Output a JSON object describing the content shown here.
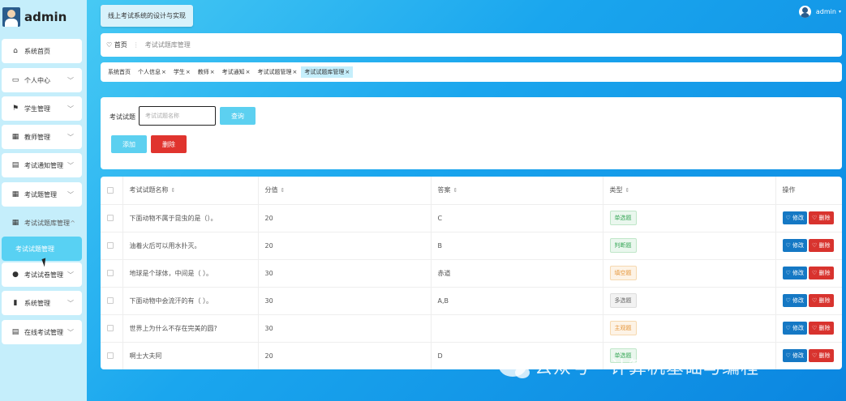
{
  "app": {
    "title": "admin",
    "system_title": "线上考试系统的设计与实现",
    "user": "admin"
  },
  "sidebar": {
    "items": [
      {
        "label": "系统首页",
        "icon": "home-icon",
        "glyph": "⌂"
      },
      {
        "label": "个人中心",
        "icon": "person-icon",
        "glyph": "▭",
        "chevron": "﹀"
      },
      {
        "label": "学生管理",
        "icon": "flag-icon",
        "glyph": "⚑",
        "chevron": "﹀"
      },
      {
        "label": "教师管理",
        "icon": "grid-icon",
        "glyph": "▦",
        "chevron": "﹀"
      },
      {
        "label": "考试通知管理",
        "icon": "clipboard-icon",
        "glyph": "▤",
        "chevron": "﹀"
      },
      {
        "label": "考试题管理",
        "icon": "grid-icon",
        "glyph": "▦",
        "chevron": "﹀"
      },
      {
        "label": "考试试题库管理",
        "icon": "grid-icon",
        "glyph": "▦",
        "chevron": "^"
      },
      {
        "label": "考试试题管理",
        "icon": "sub-item",
        "glyph": ""
      },
      {
        "label": "考试试卷管理",
        "icon": "pin-icon",
        "glyph": "●",
        "chevron": "﹀"
      },
      {
        "label": "系统管理",
        "icon": "chart-icon",
        "glyph": "▮",
        "chevron": "﹀"
      },
      {
        "label": "在线考试管理",
        "icon": "doc-icon",
        "glyph": "▤",
        "chevron": "﹀"
      }
    ]
  },
  "breadcrumb": {
    "home": "♡ 首页",
    "sep": "⋮",
    "current": "考试试题库管理"
  },
  "tabs": [
    {
      "label": "系统首页",
      "close": ""
    },
    {
      "label": "个人信息",
      "close": "×"
    },
    {
      "label": "学生",
      "close": "×"
    },
    {
      "label": "教师",
      "close": "×"
    },
    {
      "label": "考试通知",
      "close": "×"
    },
    {
      "label": "考试试题管理",
      "close": "×"
    },
    {
      "label": "考试试题库管理",
      "close": "×"
    }
  ],
  "search": {
    "label": "考试试题",
    "placeholder": "考试试题名称",
    "query_button": "查询",
    "add_button": "添加",
    "delete_button": "删除"
  },
  "table": {
    "headers": [
      "考试试题名称",
      "分值",
      "答案",
      "类型",
      "操作"
    ],
    "sort_glyph": "⇕",
    "rows": [
      {
        "name": "下面动物不属于昆虫的是（）。",
        "score": "20",
        "answer": "C",
        "type": "单选题",
        "cls": "t-single"
      },
      {
        "name": "油着火后可以用水扑灭。",
        "score": "20",
        "answer": "B",
        "type": "判断题",
        "cls": "t-judge"
      },
      {
        "name": "地球是个球体，中间是（ ）。",
        "score": "30",
        "answer": "赤道",
        "type": "填空题",
        "cls": "t-fill"
      },
      {
        "name": "下面动物中会流汗的有（ ）。",
        "score": "30",
        "answer": "A,B",
        "type": "多选题",
        "cls": "t-multi"
      },
      {
        "name": "世界上为什么不存在完美的圆?",
        "score": "30",
        "answer": "",
        "type": "主观题",
        "cls": "t-subj"
      },
      {
        "name": "啊士大夫阿",
        "score": "20",
        "answer": "D",
        "type": "单选题",
        "cls": "t-single"
      }
    ],
    "edit_label": "♡ 修改",
    "delete_label": "♡ 删除"
  },
  "watermark": "公众号 · 计算机基础与编程",
  "colors": {
    "accent": "#5cd0f0",
    "danger": "#e0342e",
    "edit": "#1578c4",
    "sidebar": "#c5eefb"
  }
}
